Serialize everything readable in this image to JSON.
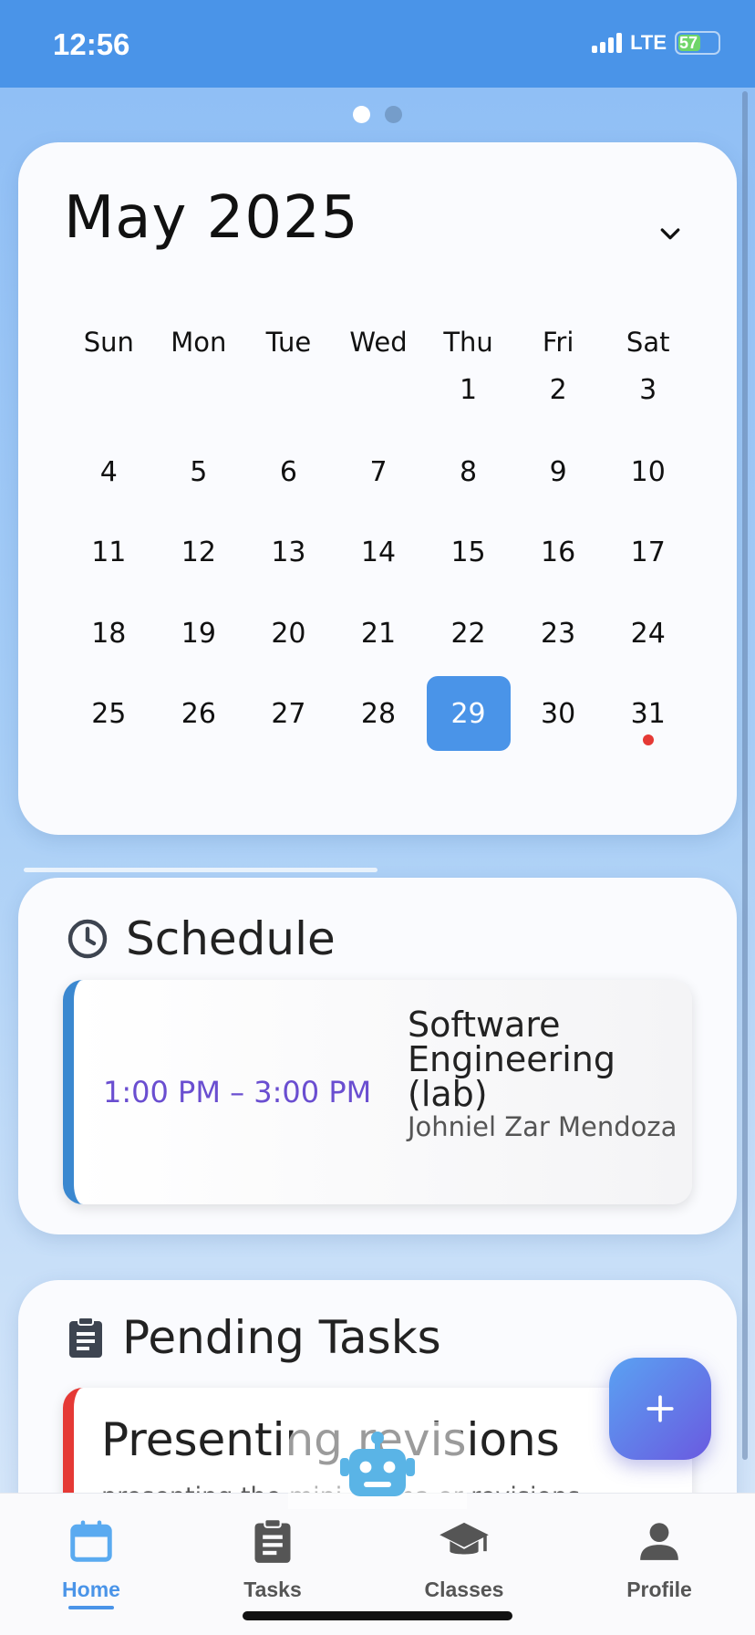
{
  "status_bar": {
    "time": "12:56",
    "network": "LTE",
    "battery": "57"
  },
  "pager": {
    "pages": 2,
    "active": 0
  },
  "calendar": {
    "month_title": "May 2025",
    "weekdays": [
      "Sun",
      "Mon",
      "Tue",
      "Wed",
      "Thu",
      "Fri",
      "Sat"
    ],
    "weeks": [
      [
        "",
        "",
        "",
        "",
        "1",
        "2",
        "3"
      ],
      [
        "4",
        "5",
        "6",
        "7",
        "8",
        "9",
        "10"
      ],
      [
        "11",
        "12",
        "13",
        "14",
        "15",
        "16",
        "17"
      ],
      [
        "18",
        "19",
        "20",
        "21",
        "22",
        "23",
        "24"
      ],
      [
        "25",
        "26",
        "27",
        "28",
        "29",
        "30",
        "31"
      ]
    ],
    "selected_day": "29",
    "event_days": [
      "31"
    ]
  },
  "schedule": {
    "title": "Schedule",
    "items": [
      {
        "time": "1:00 PM – 3:00 PM",
        "course": "Software Engineering (lab)",
        "instructor": "Johniel Zar Mendoza"
      }
    ]
  },
  "pending_tasks": {
    "title": "Pending Tasks",
    "items": [
      {
        "title": "Presenting revisions",
        "description": "presenting the mini drama or revisions"
      }
    ]
  },
  "fab": {
    "icon": "plus-icon"
  },
  "bottom_nav": {
    "items": [
      {
        "label": "Home",
        "icon": "calendar-icon",
        "active": true
      },
      {
        "label": "Tasks",
        "icon": "clipboard-icon",
        "active": false
      },
      {
        "label": "Classes",
        "icon": "graduation-cap-icon",
        "active": false
      },
      {
        "label": "Profile",
        "icon": "person-icon",
        "active": false
      }
    ]
  },
  "colors": {
    "accent": "#4a94e8",
    "schedule_accent": "#3b88d0",
    "task_accent": "#e53935",
    "time_text": "#6a4ed0"
  }
}
